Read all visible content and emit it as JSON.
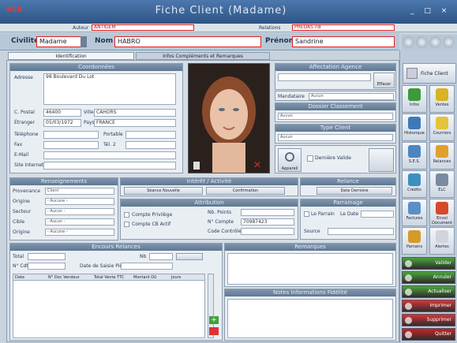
{
  "window": {
    "logo": "ASB",
    "title": "Fiche Client (Madame)",
    "controls": "_ □ ×"
  },
  "info": {
    "auteur_label": "Auteur",
    "auteur_value": "ANTIGEM",
    "relations_label": "Relations",
    "relations_value": "PREDAS n8"
  },
  "identity": {
    "civilite_label": "Civilité",
    "civilite_value": "Madame",
    "nom_label": "Nom",
    "nom_value": "HABRO",
    "prenom_label": "Prénom",
    "prenom_value": "Sandrine",
    "nav_icons": [
      "first-icon",
      "prev-icon",
      "next-icon",
      "last-icon"
    ]
  },
  "tabs": [
    {
      "label": "Identification",
      "active": true
    },
    {
      "label": "Infos Compléments et Remarques",
      "active": false
    }
  ],
  "coordonnees": {
    "title": "Coordonnées",
    "adresse_label": "Adresse",
    "adresse_value": "98 Boulevard Du Lot",
    "cpostal_label": "C. Postal",
    "cpostal_value": "46400",
    "ville_label": "Ville",
    "ville_value": "CAHORS",
    "etranger_label": "Étranger",
    "etranger_value": "05/03/1972",
    "pays_label": "Pays",
    "pays_value": "FRANCE",
    "telephone_label": "Téléphone",
    "portable_label": "Portable",
    "fax_label": "Fax",
    "tel2_label": "Tél. 2",
    "email_label": "E-Mail",
    "site_label": "Site Internet"
  },
  "affectation": {
    "title": "Affectation Agence",
    "button": "Effacer",
    "mandataire_label": "Mandataire",
    "mandataire_value": "Aucun"
  },
  "dossier": {
    "title": "Dossier Classement",
    "value": "Aucun"
  },
  "type_client": {
    "title": "Type Client",
    "value": "Aucun"
  },
  "photo": {
    "btn_label": "Appareil",
    "checkbox_label": "Dernière Valide"
  },
  "renseignements": {
    "title": "Renseignements",
    "rows": [
      {
        "label": "Provenance",
        "value": "Client"
      },
      {
        "label": "Origine",
        "value": "- Aucune -"
      },
      {
        "label": "Secteur",
        "value": "- Aucun -"
      },
      {
        "label": "Cible",
        "value": "- Aucun -"
      },
      {
        "label": "Origine",
        "value": "- Aucune -"
      }
    ]
  },
  "interet": {
    "title": "Intérêt / Activité",
    "left_btn": "Séance Nouvelle",
    "right_btn": "Confirmation"
  },
  "relance": {
    "title": "Relance",
    "btn": "Date Dernière"
  },
  "attribution": {
    "title": "Attribution",
    "check1": "Compte Privilège",
    "check2": "Compte CB Actif",
    "nb_label": "Nb. Points",
    "num_label": "N° Compte",
    "num_value": "70987423",
    "code_label": "Code Contrôle"
  },
  "parrainage": {
    "title": "Parrainage",
    "check_label": "Le Parrain",
    "date_label": "Le Date",
    "source_label": "Source"
  },
  "creditation": {
    "title": "Encours Relances",
    "fields": [
      "Total",
      "N° Cdt",
      "Date de Saisie Pièce",
      "Nb"
    ],
    "columns": [
      "Date",
      "N° Doc Vendeur",
      "Total Vente TTC",
      "Montant Dû",
      "Jours"
    ]
  },
  "remarques": {
    "title": "Remarques"
  },
  "notes": {
    "title": "Notes Informations Fidélité"
  },
  "sidebar": {
    "close_label": "Fiche Client",
    "buttons": [
      {
        "label": "Infos",
        "icon": "info-icon",
        "color": "#3d9a3a"
      },
      {
        "label": "Ventes",
        "icon": "sales-icon",
        "color": "#d8b323"
      },
      {
        "label": "Historique",
        "icon": "history-icon",
        "color": "#3f78b8"
      },
      {
        "label": "Courriers",
        "icon": "mail-icon",
        "color": "#e3c33b"
      },
      {
        "label": "S.E.S.",
        "icon": "ses-icon",
        "color": "#4b86c2"
      },
      {
        "label": "Relances",
        "icon": "relance-icon",
        "color": "#e0a030"
      },
      {
        "label": "Crédits",
        "icon": "credit-icon",
        "color": "#3d8fc0"
      },
      {
        "label": "ELC",
        "icon": "check-icon",
        "color": "#7a8aa0"
      },
      {
        "label": "Factures",
        "icon": "invoice-icon",
        "color": "#5b8fc5"
      },
      {
        "label": "Envoi Document",
        "icon": "doc-icon",
        "color": "#d44a2a"
      },
      {
        "label": "Parrains",
        "icon": "group-icon",
        "color": "#d49a2a"
      },
      {
        "label": "Alertes",
        "icon": "alert-icon",
        "color": "#d1d4da"
      }
    ],
    "status": [
      {
        "label": "Valider",
        "icon": "ok-icon",
        "color": "#4aa53b"
      },
      {
        "label": "Annuler",
        "icon": "cancel-icon",
        "color": "#4aa53b"
      },
      {
        "label": "Actualiser",
        "icon": "refresh-icon",
        "color": "#4aa53b"
      },
      {
        "label": "Imprimer",
        "icon": "print-icon",
        "color": "#d33"
      },
      {
        "label": "Supprimer",
        "icon": "delete-icon",
        "color": "#d33"
      },
      {
        "label": "Quitter",
        "icon": "quit-icon",
        "color": "#c22"
      }
    ]
  }
}
